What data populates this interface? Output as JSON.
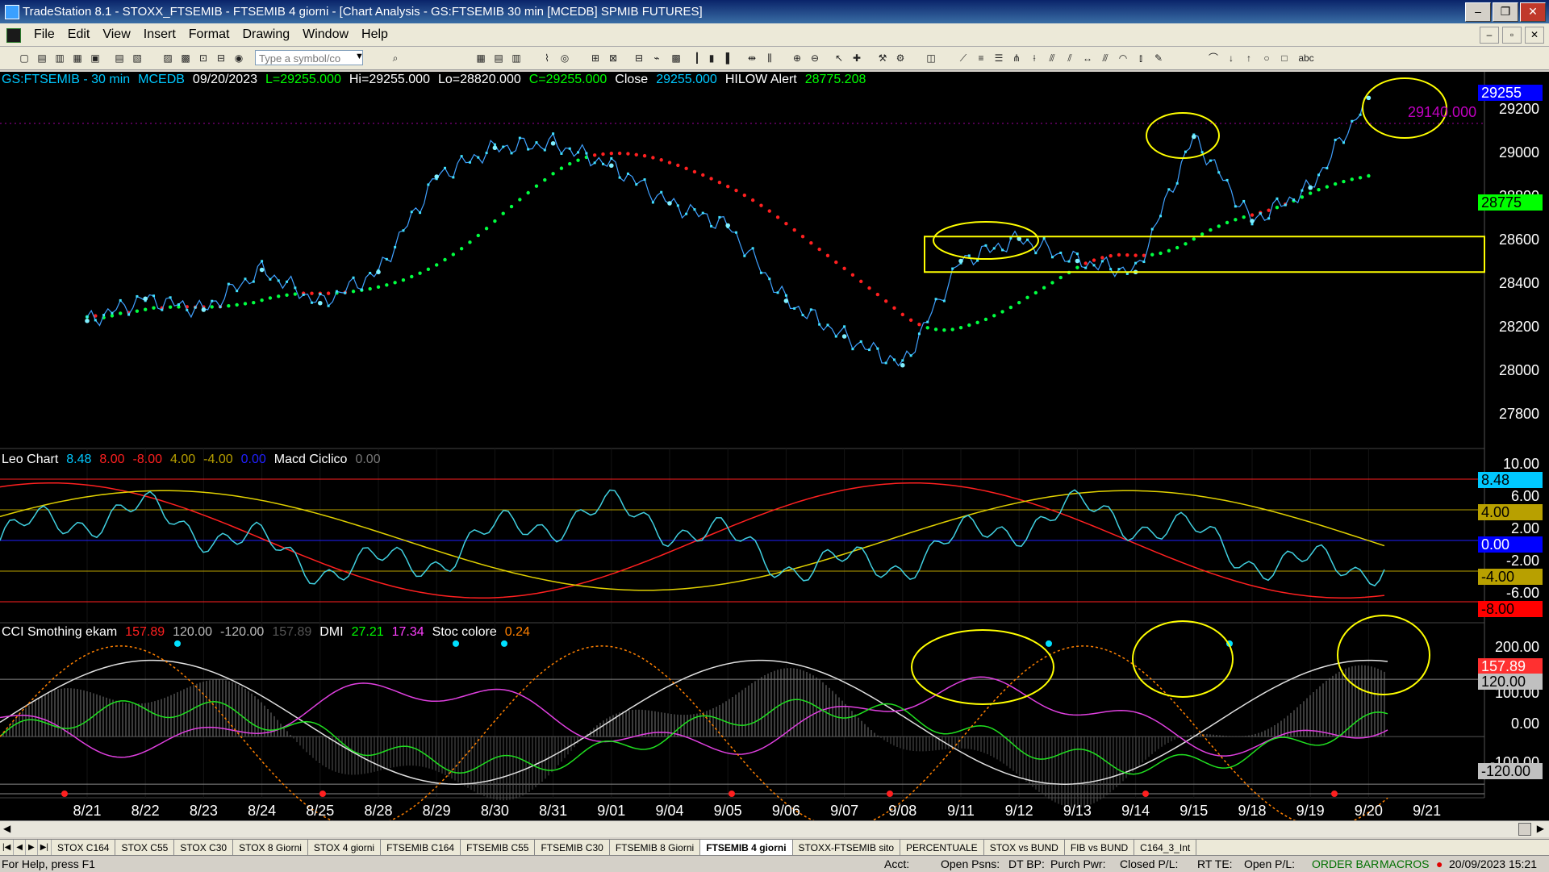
{
  "window": {
    "title": "TradeStation 8.1 - STOXX_FTSEMIB - FTSEMIB  4 giorni - [Chart Analysis - GS:FTSEMIB  30 min  [MCEDB] SPMIB FUTURES]",
    "min_label": "–",
    "max_label": "❐",
    "close_label": "✕"
  },
  "menu": {
    "items": [
      "File",
      "Edit",
      "View",
      "Insert",
      "Format",
      "Drawing",
      "Window",
      "Help"
    ]
  },
  "toolbar": {
    "symbol_placeholder": "Type a symbol/co"
  },
  "price_header": {
    "symbol": "GS:FTSEMIB - 30 min",
    "source": "MCEDB",
    "date": "09/20/2023",
    "last": "L=29255.000",
    "hi": "Hi=29255.000",
    "lo": "Lo=28820.000",
    "close_c": "C=29255.000",
    "close_label": "Close",
    "close_value": "29255.000",
    "alert_label": "HILOW Alert",
    "alert_value": "28775.208"
  },
  "osc_header": {
    "name": "Leo Chart",
    "v1": "8.48",
    "v2": "8.00",
    "v3": "-8.00",
    "v4": "4.00",
    "v5": "-4.00",
    "v6": "0.00",
    "name2": "Macd Ciclico",
    "v7": "0.00"
  },
  "cci_header": {
    "name": "CCI Smothing ekam",
    "v1": "157.89",
    "v2": "120.00",
    "v3": "-120.00",
    "v4": "157.89",
    "name2": "DMI",
    "v5": "27.21",
    "v6": "17.34",
    "name3": "Stoc colore",
    "v7": "0.24"
  },
  "price_axis": [
    "29200",
    "29000",
    "28800",
    "28600",
    "28400",
    "28200",
    "28000",
    "27800"
  ],
  "price_boxes": {
    "last": "29255",
    "alert": "28775",
    "overlay_value": "29140.000"
  },
  "osc_axis": [
    "10.00",
    "6.00",
    "2.00",
    "-2.00",
    "-6.00"
  ],
  "osc_boxes": {
    "a": "8.48",
    "b": "4.00",
    "c": "0.00",
    "d": "-4.00",
    "e": "-8.00"
  },
  "cci_axis": [
    "200.00",
    "100.00",
    "0.00",
    "-100.00"
  ],
  "cci_boxes": {
    "a": "157.89",
    "b": "120.00",
    "c": "-120.00"
  },
  "dates": [
    "8/21",
    "8/22",
    "8/23",
    "8/24",
    "8/25",
    "8/28",
    "8/29",
    "8/30",
    "8/31",
    "9/01",
    "9/04",
    "9/05",
    "9/06",
    "9/07",
    "9/08",
    "9/11",
    "9/12",
    "9/13",
    "9/14",
    "9/15",
    "9/18",
    "9/19",
    "9/20",
    "9/21"
  ],
  "tabs": [
    "STOX C164",
    "STOX C55",
    "STOX C30",
    "STOX 8 Giorni",
    "STOX 4 giorni",
    "FTSEMIB C164",
    "FTSEMIB C55",
    "FTSEMIB C30",
    "FTSEMIB 8 Giorni",
    "FTSEMIB 4 giorni",
    "STOXX-FTSEMIB sito",
    "PERCENTUALE",
    "STOX vs BUND",
    "FIB vs BUND",
    "C164_3_Int"
  ],
  "active_tab": "FTSEMIB 4 giorni",
  "status": {
    "help": "For Help, press F1",
    "acct": "Acct:",
    "open_psns": "Open Psns:",
    "dt_bp": "DT BP:",
    "purch_pwr": "Purch Pwr:",
    "closed_pl": "Closed P/L:",
    "rt_te": "RT TE:",
    "open_pl": "Open P/L:",
    "order_bar": "ORDER BAR",
    "macros": "MACROS",
    "datetime": "20/09/2023 15:21"
  },
  "chart_data": {
    "type": "line",
    "x": [
      "8/21",
      "8/22",
      "8/23",
      "8/24",
      "8/25",
      "8/28",
      "8/29",
      "8/30",
      "8/31",
      "9/01",
      "9/04",
      "9/05",
      "9/06",
      "9/07",
      "9/08",
      "9/11",
      "9/12",
      "9/13",
      "9/14",
      "9/15",
      "9/18",
      "9/19",
      "9/20"
    ],
    "series": [
      {
        "name": "GS:FTSEMIB - 30 min",
        "values": [
          28250,
          28350,
          28300,
          28480,
          28330,
          28470,
          28900,
          29030,
          29050,
          28950,
          28780,
          28680,
          28340,
          28180,
          28050,
          28520,
          28620,
          28520,
          28470,
          29080,
          28700,
          28850,
          29255
        ]
      }
    ],
    "ylim": [
      27700,
      29300
    ]
  }
}
